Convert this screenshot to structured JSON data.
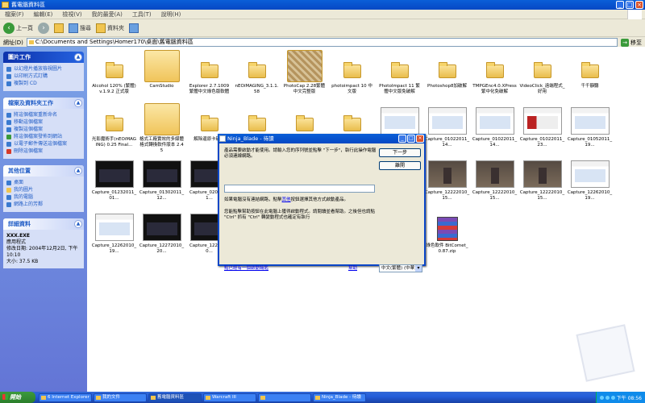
{
  "window": {
    "title": "舊電腦資料區"
  },
  "menubar": {
    "items": [
      "檔案(F)",
      "編輯(E)",
      "檢視(V)",
      "我的最愛(A)",
      "工具(T)",
      "說明(H)"
    ]
  },
  "toolbar": {
    "back": "上一頁",
    "search": "搜尋",
    "folders": "資料夾"
  },
  "address": {
    "label": "網址(D)",
    "path": "C:\\Documents and Settings\\Homer170\\桌面\\舊電腦資料區",
    "go": "移至"
  },
  "sidebar": {
    "picture_tasks": {
      "title": "圖片工作",
      "items": [
        "以幻燈片播放檢視圖片",
        "以印刷方式訂購",
        "複製到 CD"
      ]
    },
    "file_tasks": {
      "title": "檔案及資料夾工作",
      "items": [
        "將這個檔案重新命名",
        "移動這個檔案",
        "複製這個檔案",
        "將這個檔案發佈到網站",
        "以電子郵件傳送這個檔案",
        "刪除這個檔案"
      ]
    },
    "other_places": {
      "title": "其他位置",
      "items": [
        "桌面",
        "我的圖片",
        "我的電腦",
        "網路上的芳鄰"
      ]
    },
    "details": {
      "title": "詳細資料",
      "name": "XXX.EXE",
      "type": "應用程式",
      "modified": "修改日期: 2004年12月2日, 下午 10:10",
      "size": "大小: 37.5 KB"
    }
  },
  "files": [
    {
      "kind": "folder",
      "label": "Alcohol 120% (繁體) v.1.9.2 正式版"
    },
    {
      "kind": "bigfolder",
      "label": "CamStudio"
    },
    {
      "kind": "folder",
      "label": "Explorer 2.7.1009 繁體中文綠色版軟體"
    },
    {
      "kind": "folder",
      "label": "nEOiMAGING_3.1.1.58"
    },
    {
      "kind": "bigfolder-pattern",
      "label": "PhotoCap 2.28繁體中文完整版"
    },
    {
      "kind": "folder",
      "label": "photoimpact 10 中文版"
    },
    {
      "kind": "folder",
      "label": "PhotoImpact 11 繁體中文版免破解"
    },
    {
      "kind": "folder",
      "label": "Photoshop8加破解"
    },
    {
      "kind": "folder",
      "label": "TMPGEnc4.0.XPress繁中化免破解"
    },
    {
      "kind": "folder",
      "label": "VideoClick_遠端程式_好用"
    },
    {
      "kind": "folder",
      "label": "千千靜聽"
    },
    {
      "kind": "folder",
      "label": "光影魔術手(nEOiMAGING) 0.25 Final..."
    },
    {
      "kind": "bigfolder",
      "label": "格式工廠實效的多媒體格式轉換軟件版本 2.45"
    },
    {
      "kind": "folder",
      "label": "解除還原卡破解"
    },
    {
      "kind": "folder",
      "label": ""
    },
    {
      "kind": "folder",
      "label": ""
    },
    {
      "kind": "folder",
      "label": ""
    },
    {
      "kind": "shot",
      "label": ""
    },
    {
      "kind": "shot",
      "label": "Capture_01022011_14..."
    },
    {
      "kind": "shot",
      "label": "Capture_01022011_14..."
    },
    {
      "kind": "shot-red",
      "label": "Capture_01022011_23..."
    },
    {
      "kind": "shot",
      "label": "Capture_01052011_19..."
    },
    {
      "kind": "shot-dark",
      "label": "Capture_01232011_01..."
    },
    {
      "kind": "shot-dark",
      "label": "Capture_01302011_12..."
    },
    {
      "kind": "shot-dark",
      "label": "Capture_02072011..."
    },
    {
      "kind": "none",
      "label": ""
    },
    {
      "kind": "none",
      "label": ""
    },
    {
      "kind": "none",
      "label": ""
    },
    {
      "kind": "none",
      "label": ""
    },
    {
      "kind": "shot-game",
      "label": "Capture_12222010_15..."
    },
    {
      "kind": "shot-game",
      "label": "Capture_12222010_15..."
    },
    {
      "kind": "shot-game",
      "label": "Capture_12222010_15..."
    },
    {
      "kind": "shot",
      "label": "Capture_12262010_19..."
    },
    {
      "kind": "shot",
      "label": "Capture_12262010_19..."
    },
    {
      "kind": "shot-dark",
      "label": "Capture_12272010_20..."
    },
    {
      "kind": "shot-dark",
      "label": "Capture_12272010..."
    },
    {
      "kind": "none",
      "label": ""
    },
    {
      "kind": "none",
      "label": ""
    },
    {
      "kind": "none",
      "label": ""
    },
    {
      "kind": "none",
      "label": ""
    },
    {
      "kind": "rar",
      "label": "綠色軟件 BitComet_0.87.zip"
    }
  ],
  "dialog": {
    "title": "Ninja_Blade - 待讀",
    "intro": "產品需要啟動才能使用。請輸入您的序列號並點擊 \"下一步\"，執行此操作電腦必須連線網路。",
    "next": "下一步",
    "help_btn": "離開",
    "offline_a": "如果電腦沒有連結網路，點擊",
    "offline_link": "其他",
    "offline_b": "按鈕選擇其他方式啟動產品。",
    "note": "您能點擊幫助按鈕在此電腦上獲得啟動程式。請閱讀並看幫助。之後但也請點 \"Ctrl\" 抓有 \"Ctrl\" 轉變動程式也確定有執行",
    "bottom_link": "點已經有一個啟動鑰匙",
    "help_link": "幫助",
    "language": "中文(繁體) (中華)"
  },
  "taskbar": {
    "start": "開始",
    "tasks": [
      "6 Internet Explorer",
      "我的文件",
      "舊電腦資料區",
      "Warcraft III",
      "",
      "Ninja_Blade - 待讀"
    ],
    "clock": "下午 08:56"
  }
}
